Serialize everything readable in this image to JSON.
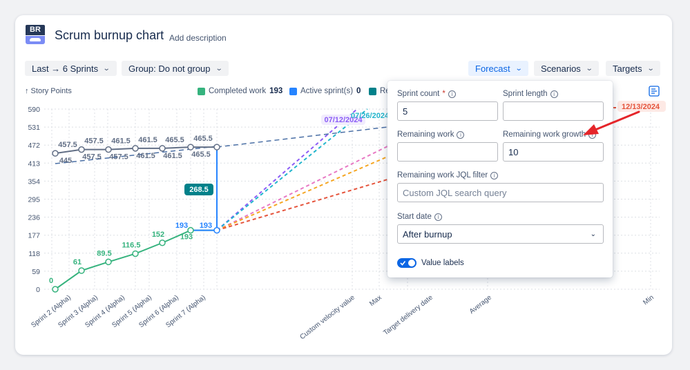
{
  "header": {
    "logo_text": "BR",
    "title": "Scrum burnup chart",
    "add_description": "Add description"
  },
  "toolbar": {
    "range": "Last → 6 Sprints",
    "group": "Group: Do not group",
    "forecast": "Forecast",
    "scenarios": "Scenarios",
    "targets": "Targets"
  },
  "legend": [
    {
      "label": "Completed work",
      "value": "193",
      "color": "#36b37e"
    },
    {
      "label": "Active sprint(s)",
      "value": "0",
      "color": "#2684ff"
    },
    {
      "label": "Re",
      "value": "",
      "color": "#00818a"
    }
  ],
  "chart_data": {
    "type": "line",
    "ylabel": "↑ Story Points",
    "yticks": [
      "590",
      "531",
      "472",
      "413",
      "354",
      "295",
      "236",
      "177",
      "118",
      "59",
      "0"
    ],
    "ylim": [
      0,
      590
    ],
    "x_sprints": [
      "Sprint 2 (Alpha)",
      "Sprint 3 (Alpha)",
      "Sprint 4 (Alpha)",
      "Sprint 5 (Alpha)",
      "Sprint 6 (Alpha)",
      "Sprint 7 (Alpha)"
    ],
    "x_forecast": [
      "Custom velocity value",
      "Max",
      "Target delivery date",
      "Average",
      "Min"
    ],
    "series": [
      {
        "name": "Completed work",
        "color": "#36b37e",
        "values": [
          0,
          61,
          89.5,
          116.5,
          152,
          193,
          193
        ]
      },
      {
        "color": "#626f86",
        "values": [
          445,
          457.5,
          457.5,
          461.5,
          461.5,
          465.5,
          465.5
        ]
      }
    ],
    "value_labels": {
      "completed": [
        "0",
        "61",
        "89.5",
        "116.5",
        "152",
        "193",
        "193"
      ],
      "scope_upper": [
        "457.5",
        "457.5",
        "461.5",
        "461.5",
        "465.5",
        "465.5"
      ],
      "scope_lower": [
        "445",
        "457.5",
        "457.5",
        "461.5",
        "461.5",
        "465.5"
      ],
      "active_sprint_value": "193",
      "gap_label": "268.5"
    },
    "forecast_lines": [
      {
        "color": "#8b5cf6"
      },
      {
        "color": "#22b5cc"
      },
      {
        "color": "#e879c4"
      },
      {
        "color": "#f5a623"
      },
      {
        "color": "#e5533b"
      }
    ],
    "date_labels": [
      {
        "text": "07/12/2024",
        "color": "#8b5cf6"
      },
      {
        "text": "07/26/2024",
        "color": "#22b5cc"
      },
      {
        "text": "12/13/2024",
        "color": "#e5533b"
      }
    ]
  },
  "forecast_panel": {
    "sprint_count_label": "Sprint count",
    "required_mark": "*",
    "sprint_count_value": "5",
    "sprint_length_label": "Sprint length",
    "sprint_length_value": "",
    "remaining_work_label": "Remaining work",
    "remaining_work_value": "",
    "remaining_growth_label": "Remaining work growth",
    "remaining_growth_value": "10",
    "jql_label": "Remaining work JQL filter",
    "jql_placeholder": "Custom JQL search query",
    "start_date_label": "Start date",
    "start_date_value": "After burnup",
    "value_labels_label": "Value labels",
    "value_labels_on": true
  },
  "colors": {
    "accent": "#0c66e4",
    "annotation_arrow": "#e5252a"
  }
}
